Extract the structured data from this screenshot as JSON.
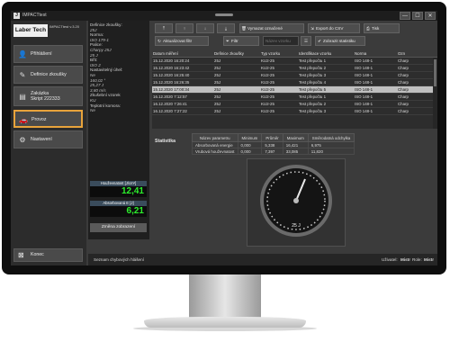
{
  "window": {
    "title": "IMPACTtest",
    "minimize": "—",
    "maximize": "☐",
    "close": "✕"
  },
  "sidebar": {
    "logo": "Laber Tech",
    "version": "IMPACTtest v.3.20",
    "items": [
      {
        "label": "Přihlášení",
        "icon": "user-icon",
        "glyph": "👤"
      },
      {
        "label": "Definice zkoušky",
        "icon": "pencil-icon",
        "glyph": "✎"
      },
      {
        "label": "Zakázka",
        "label2": "Skript 222333",
        "icon": "document-icon",
        "glyph": "▤"
      },
      {
        "label": "Provoz",
        "icon": "car-icon",
        "glyph": "🚗"
      },
      {
        "label": "Nastavení",
        "icon": "gear-icon",
        "glyph": "⚙"
      }
    ],
    "exit": {
      "label": "Konec",
      "icon": "exit-icon",
      "glyph": "⊠"
    }
  },
  "details": {
    "def_label": "Definice zkoušky:",
    "def_value": "25J",
    "norm_label": "Norma:",
    "norm_value": "ISO 179-1",
    "hammer_label": "Palice:",
    "hammer_value1": "Charpy 25J",
    "hammer_value2": "25 J",
    "blade_label": "Břit:",
    "blade_value": "ISO 2",
    "angle_label": "Nastavitelný úhel:",
    "angle_value1": "Ne",
    "angle_value2": "160,02 °",
    "angle_value3": "25,27 J",
    "angle_value4": "3,80 m/s",
    "sample_label": "Zkušební vzorek",
    "sample_value": "KU",
    "temp_label": "Teplotní komora:",
    "temp_value": "Ne"
  },
  "meters": [
    {
      "label": "Houževnatost [J/cm²]",
      "value": "12,41"
    },
    {
      "label": "Absorbovaná E [J]",
      "value": "6,21"
    }
  ],
  "zmena_label": "Změna zobrazení",
  "toolbar": {
    "btn_top": "⤒",
    "btn_up": "↑",
    "btn_down": "↓",
    "btn_bottom": "⤓",
    "delete_label": "Vymazat označené",
    "export_label": "Export do CSV",
    "print_label": "Tisk",
    "refresh_label": "Aktualizovat filtr",
    "filter_label": "Filtr",
    "sample_name_placeholder": "Název vzorku",
    "stats_label": "Zobrazit statistiku"
  },
  "table": {
    "columns": [
      "Datum měření",
      "Definice zkoušky",
      "Typ vzorku",
      "Identifikace vzorku",
      "Norma",
      "Ozn"
    ],
    "rows": [
      [
        "15.12.2020 16:20:24",
        "25J",
        "KU2-25",
        "Test přepočtu 1",
        "ISO 148-1",
        "Charp"
      ],
      [
        "15.12.2020 16:23:42",
        "25J",
        "KU2-25",
        "Test přepočtu 2",
        "ISO 148-1",
        "Charp"
      ],
      [
        "15.12.2020 16:25:40",
        "25J",
        "KU2-25",
        "Test přepočtu 3",
        "ISO 148-1",
        "Charp"
      ],
      [
        "15.12.2020 16:26:35",
        "25J",
        "KU2-25",
        "Test přepočtu 4",
        "ISO 148-1",
        "Charp"
      ],
      [
        "15.12.2020 17:00:34",
        "25J",
        "KU2-25",
        "Test přepočtu 5",
        "ISO 148-1",
        "Charp"
      ],
      [
        "16.12.2020 7:12:57",
        "25J",
        "KU2-25",
        "Test přepočtu 1",
        "ISO 148-1",
        "Charp"
      ],
      [
        "16.12.2020 7:26:41",
        "25J",
        "KU2-25",
        "Test přepočtu 2",
        "ISO 148-1",
        "Charp"
      ],
      [
        "16.12.2020 7:27:22",
        "25J",
        "KU2-25",
        "Test přepočtu 3",
        "ISO 148-1",
        "Charp"
      ]
    ],
    "selected_row": 4
  },
  "statistics": {
    "label": "Statistika",
    "columns": [
      "Název parametru",
      "Minimum",
      "Průměr",
      "Maximum",
      "Směrodatná odchylka"
    ],
    "rows": [
      [
        "Absorbovaná energie",
        "0,000",
        "5,338",
        "16,421",
        "6,975"
      ],
      [
        "Vrubová houževnatost",
        "0,000",
        "7,397",
        "33,085",
        "11,820"
      ]
    ]
  },
  "gauge": {
    "label": "25 J"
  },
  "status": {
    "link": "Seznam chybových hlášení",
    "user_label": "Uživatel:",
    "user_value": "Mistr",
    "role_label": "Role:",
    "role_value": "Mistr"
  }
}
